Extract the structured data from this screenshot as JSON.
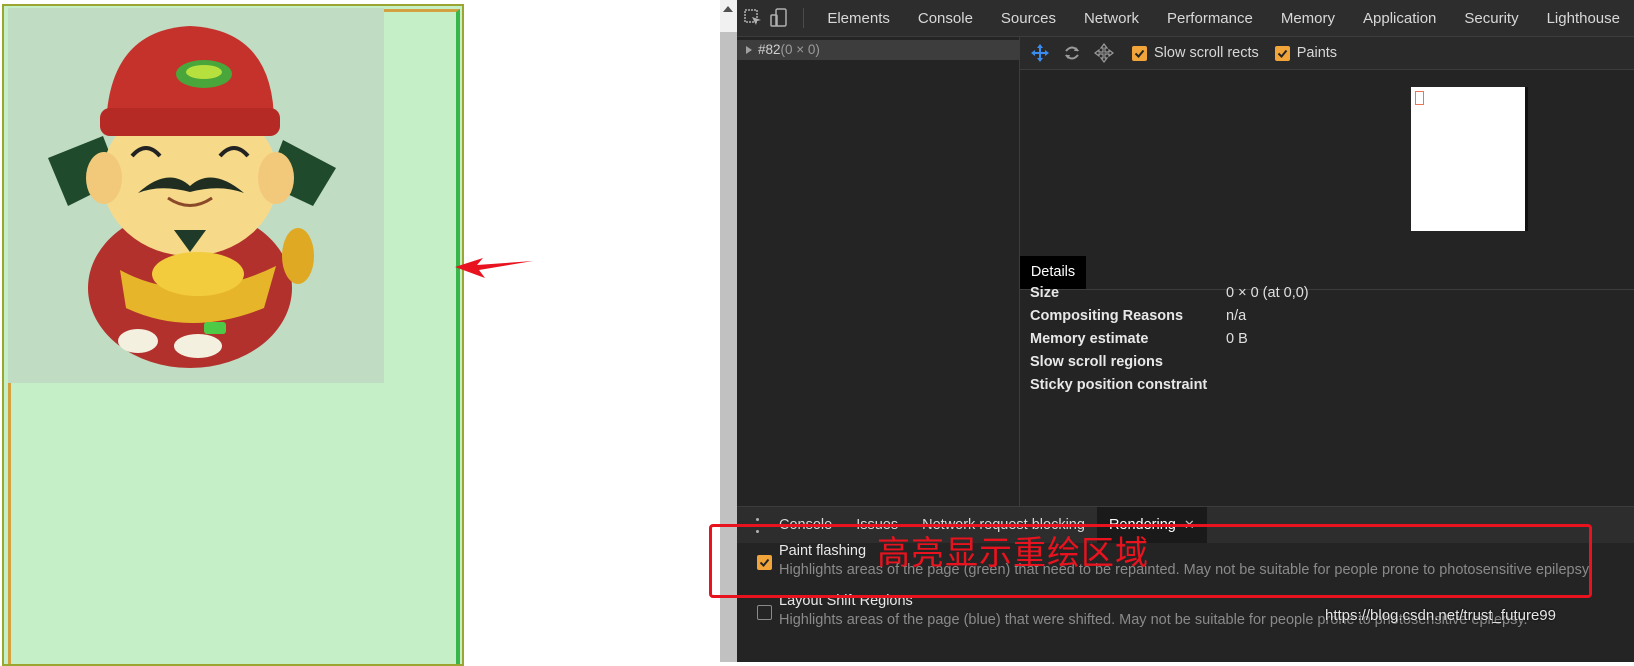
{
  "devtools": {
    "main_tabs": [
      "Elements",
      "Console",
      "Sources",
      "Network",
      "Performance",
      "Memory",
      "Application",
      "Security",
      "Lighthouse"
    ],
    "layers": {
      "row_name": "#82",
      "row_size": "(0 × 0)",
      "toolbar": {
        "slow_scroll_label": "Slow scroll rects",
        "paints_label": "Paints"
      },
      "details_tab": "Details",
      "details": [
        {
          "key": "Size",
          "value": "0 × 0 (at 0,0)"
        },
        {
          "key": "Compositing Reasons",
          "value": "n/a"
        },
        {
          "key": "Memory estimate",
          "value": "0 B"
        },
        {
          "key": "Slow scroll regions",
          "value": ""
        },
        {
          "key": "Sticky position constraint",
          "value": ""
        }
      ]
    },
    "drawer_tabs": [
      "Console",
      "Issues",
      "Network request blocking",
      "Rendering"
    ],
    "rendering": {
      "paint_flashing": {
        "title": "Paint flashing",
        "desc": "Highlights areas of the page (green) that need to be repainted. May not be suitable for people prone to photosensitive epilepsy.",
        "checked": true
      },
      "layout_shift": {
        "title": "Layout Shift Regions",
        "desc": "Highlights areas of the page (blue) that were shifted. May not be suitable for people prone to photosensitive epilepsy.",
        "checked": false
      }
    }
  },
  "annotation": {
    "note": "高亮显示重绘区域",
    "color": "#e8131e"
  },
  "watermark": "https://blog.csdn.net/trust_future99",
  "colors": {
    "accent": "#f0a43a",
    "paint_flash_green": "#c5efc7",
    "active_tool": "#3b8cf0"
  }
}
